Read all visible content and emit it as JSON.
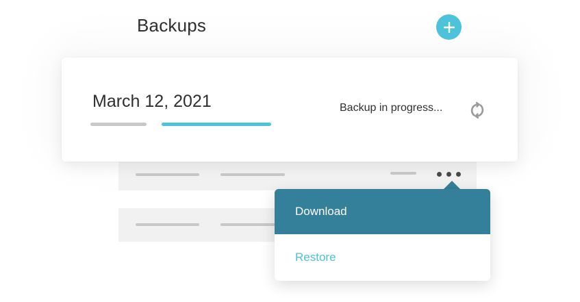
{
  "header": {
    "title": "Backups",
    "add_icon": "plus-icon"
  },
  "backup": {
    "date": "March 12, 2021",
    "status": "Backup in progress...",
    "status_icon": "sync-icon",
    "progress_fraction": 0.65
  },
  "menu": {
    "more_icon": "more-horizontal-icon",
    "items": [
      {
        "label": "Download"
      },
      {
        "label": "Restore"
      }
    ]
  },
  "colors": {
    "accent": "#4cc3da",
    "menu_active": "#347f99",
    "text": "#2f2f2f",
    "placeholder_bar": "#c8c8c8",
    "row_background": "#f1f1f1"
  }
}
